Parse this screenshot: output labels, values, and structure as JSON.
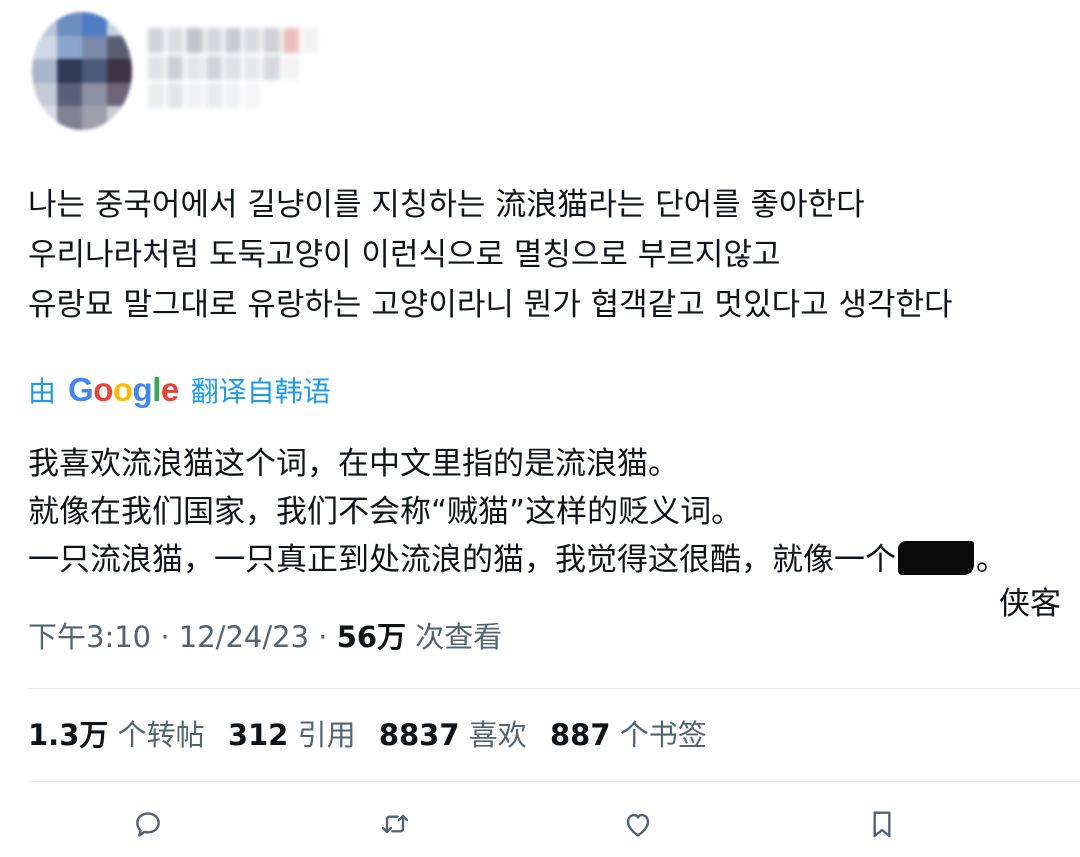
{
  "tweet": {
    "original_lines": [
      "나는 중국어에서 길냥이를 지칭하는 流浪猫라는 단어를 좋아한다",
      "우리나라처럼 도둑고양이 이런식으로 멸칭으로 부르지않고",
      "유랑묘 말그대로 유랑하는 고양이라니 뭔가 협객같고 멋있다고 생각한다"
    ],
    "translate": {
      "prefix": "由",
      "brand": "Google",
      "suffix": "翻译自韩语"
    },
    "translation_lines": [
      "我喜欢流浪猫这个词，在中文里指的是流浪猫。",
      "就像在我们国家，我们不会称“贼猫”这样的贬义词。",
      "一只流浪猫，一只真正到处流浪的猫，我觉得这很酷，就像一个"
    ],
    "translation_period": "。",
    "translation_last_word": "侠客"
  },
  "meta": {
    "time": "下午3:10",
    "sep1": " · ",
    "date": "12/24/23",
    "sep2": " · ",
    "views_count": "56万",
    "views_label": " 次查看"
  },
  "stats": [
    {
      "count": "1.3万",
      "label": "个转帖"
    },
    {
      "count": "312",
      "label": "引用"
    },
    {
      "count": "8837",
      "label": "喜欢"
    },
    {
      "count": "887",
      "label": "个书签"
    }
  ],
  "actions": [
    {
      "icon": "reply-icon"
    },
    {
      "icon": "retweet-icon"
    },
    {
      "icon": "like-icon"
    },
    {
      "icon": "bookmark-icon"
    }
  ],
  "colors": {
    "text": "#0f1419",
    "secondary": "#536471",
    "accent": "#1d9bf0",
    "divider": "#e6ecf0"
  }
}
